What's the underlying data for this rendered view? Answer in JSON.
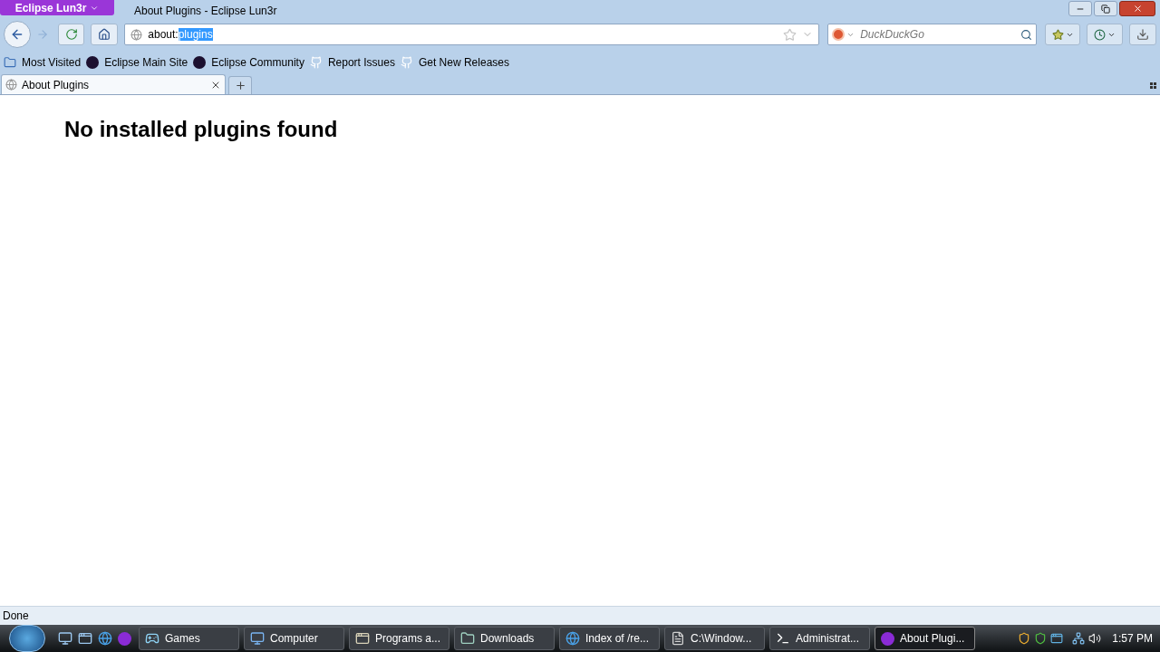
{
  "app_button": "Eclipse Lun3r",
  "window": {
    "title": "About Plugins - Eclipse Lun3r"
  },
  "address_bar": {
    "parts": [
      {
        "text": "about:",
        "selected": false
      },
      {
        "text": "plugins",
        "selected": true
      }
    ]
  },
  "search": {
    "placeholder": "DuckDuckGo"
  },
  "bookmarks": [
    {
      "label": "Most Visited",
      "kind": "folder"
    },
    {
      "label": "Eclipse Main Site",
      "kind": "eclipse"
    },
    {
      "label": "Eclipse Community",
      "kind": "eclipse"
    },
    {
      "label": "Report Issues",
      "kind": "github"
    },
    {
      "label": "Get New Releases",
      "kind": "github"
    }
  ],
  "tabs": [
    {
      "label": "About Plugins",
      "selected": true
    }
  ],
  "page": {
    "heading": "No installed plugins found"
  },
  "status_bar": "Done",
  "taskbar": {
    "buttons": [
      {
        "label": "Games",
        "kind": "games",
        "selected": false
      },
      {
        "label": "Computer",
        "kind": "computer",
        "selected": false
      },
      {
        "label": "Programs a...",
        "kind": "window",
        "selected": false
      },
      {
        "label": "Downloads",
        "kind": "folder",
        "selected": false
      },
      {
        "label": "Index of /re...",
        "kind": "ie",
        "selected": false
      },
      {
        "label": "C:\\Window...",
        "kind": "file",
        "selected": false
      },
      {
        "label": "Administrat...",
        "kind": "console",
        "selected": false
      },
      {
        "label": "About Plugi...",
        "kind": "eclipse",
        "selected": true
      }
    ],
    "clock": "1:57 PM"
  }
}
